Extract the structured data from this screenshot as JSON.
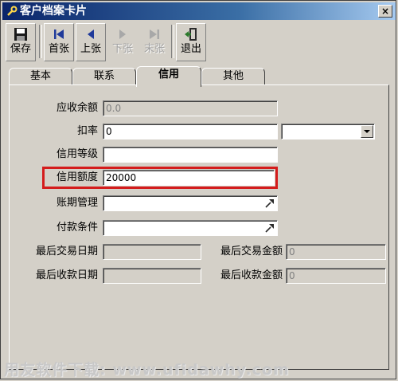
{
  "window": {
    "title": "客户档案卡片",
    "close_symbol": "×"
  },
  "toolbar": {
    "save": "保存",
    "first": "首张",
    "prev": "上张",
    "next": "下张",
    "last": "末张",
    "exit": "退出"
  },
  "tabs": [
    "基本",
    "联系",
    "信用",
    "其他"
  ],
  "active_tab": "信用",
  "form": {
    "receivable_balance": {
      "label": "应收余额",
      "value": "0.0"
    },
    "discount_rate": {
      "label": "扣率",
      "value": "0",
      "select_value": ""
    },
    "credit_level": {
      "label": "信用等级",
      "value": ""
    },
    "credit_limit": {
      "label": "信用额度",
      "value": "20000"
    },
    "account_period": {
      "label": "账期管理",
      "value": ""
    },
    "payment_terms": {
      "label": "付款条件",
      "value": ""
    },
    "last_trade_date": {
      "label": "最后交易日期",
      "value": ""
    },
    "last_trade_amount": {
      "label": "最后交易金额",
      "value": "0"
    },
    "last_receipt_date": {
      "label": "最后收款日期",
      "value": ""
    },
    "last_receipt_amount": {
      "label": "最后收款金额",
      "value": "0"
    }
  },
  "watermark": "用友软件下载: www.ufidawhy.com",
  "colors": {
    "highlight": "#d41c1c",
    "title_bar": "#0a246a"
  }
}
